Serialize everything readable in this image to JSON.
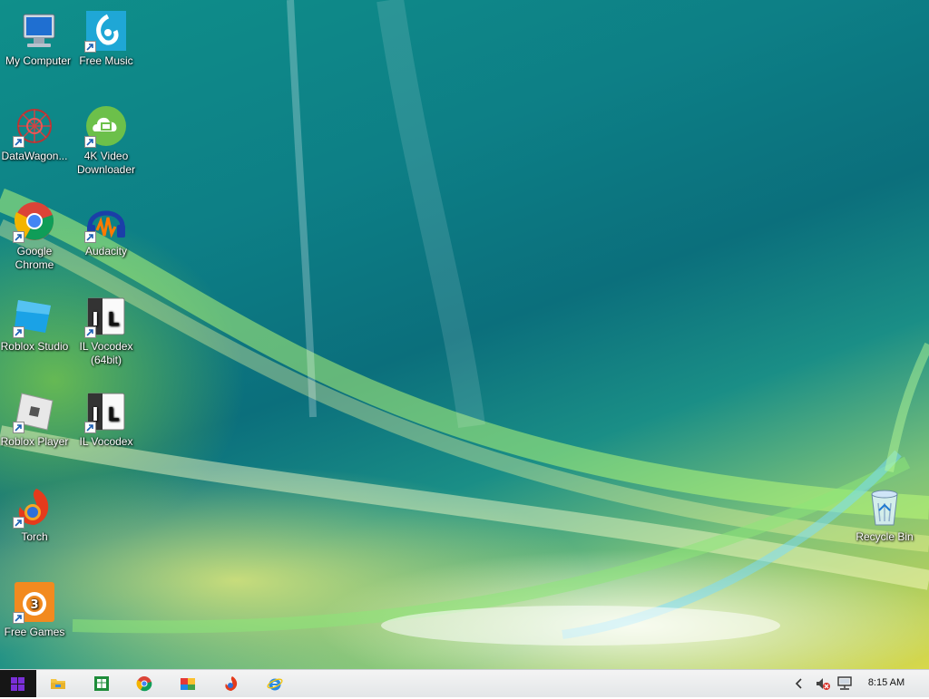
{
  "desktop": {
    "icons": [
      {
        "id": "my-computer",
        "label": "My Computer"
      },
      {
        "id": "free-music",
        "label": "Free Music"
      },
      {
        "id": "datawagon",
        "label": "DataWagon..."
      },
      {
        "id": "4k-video-downloader",
        "label": "4K Video Downloader"
      },
      {
        "id": "google-chrome",
        "label": "Google Chrome"
      },
      {
        "id": "audacity",
        "label": "Audacity"
      },
      {
        "id": "roblox-studio",
        "label": "Roblox Studio"
      },
      {
        "id": "il-vocodex-64",
        "label": "IL Vocodex (64bit)"
      },
      {
        "id": "roblox-player",
        "label": "Roblox Player"
      },
      {
        "id": "il-vocodex",
        "label": "IL Vocodex"
      },
      {
        "id": "torch",
        "label": "Torch"
      },
      {
        "id": "free-games",
        "label": "Free Games"
      },
      {
        "id": "recycle-bin",
        "label": "Recycle Bin"
      }
    ]
  },
  "taskbar": {
    "start_icon": "windows-logo-icon",
    "pinned": [
      {
        "name": "file-explorer-icon"
      },
      {
        "name": "spreadsheet-app-icon"
      },
      {
        "name": "chrome-icon"
      },
      {
        "name": "roblox-multicolor-icon"
      },
      {
        "name": "torch-icon"
      },
      {
        "name": "internet-explorer-icon"
      }
    ],
    "tray": {
      "show_hidden_icon": "chevron-left-icon",
      "volume_icon": "speaker-muted-icon",
      "network_icon": "network-icon",
      "clock": "8:15 AM"
    }
  },
  "colors": {
    "wallpaper_teal": "#0d7f86",
    "wallpaper_yellow": "#d8d84a",
    "taskbar_bg": "#eceef0",
    "start_button": "#161616",
    "windows_logo": "#7a2fd8"
  }
}
